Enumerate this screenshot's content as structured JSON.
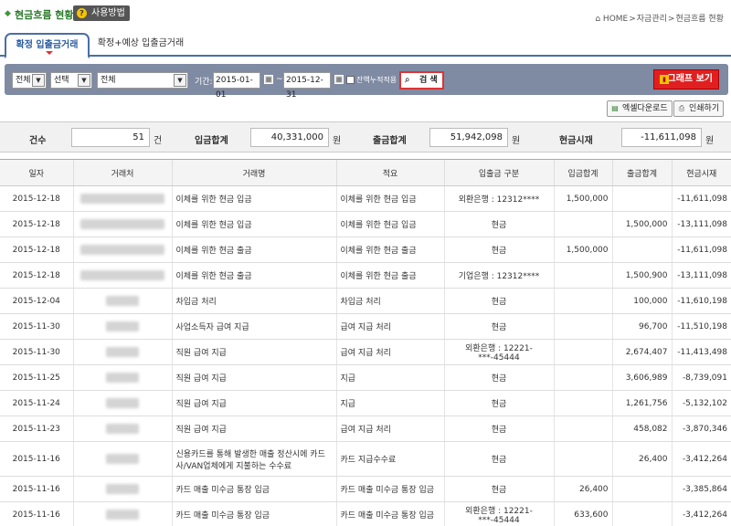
{
  "header": {
    "title": "현금흐름 현황",
    "help_label": "사용방법",
    "breadcrumb": [
      "HOME",
      "자금관리",
      "현금흐름 현황"
    ]
  },
  "tabs": [
    {
      "label": "확정 입출금거래",
      "active": true
    },
    {
      "label": "확정+예상 입출금거래",
      "active": false
    }
  ],
  "filters": {
    "select1": "전체",
    "select2": "선택",
    "select3": "전체",
    "period_label": "기간:",
    "date_from": "2015-01-01",
    "date_to": "2015-12-31",
    "period_sep": "~",
    "balance_checkbox_label": "잔액누적적용",
    "search_label": "검 색",
    "graph_label": "그래프 보기"
  },
  "toolbar": {
    "excel_label": "엑셀다운로드",
    "print_label": "인쇄하기"
  },
  "summary": {
    "count_label": "건수",
    "count_value": "51",
    "count_unit": "건",
    "in_label": "입금합계",
    "in_value": "40,331,000",
    "out_label": "출금합계",
    "out_value": "51,942,098",
    "balance_label": "현금시재",
    "balance_value": "-11,611,098",
    "won": "원"
  },
  "table": {
    "columns": [
      "일자",
      "거래처",
      "거래명",
      "적요",
      "입출금 구분",
      "입금합계",
      "출금합계",
      "현금시재"
    ],
    "rows": [
      {
        "date": "2015-12-18",
        "name": "이체를 위한 현금 입금",
        "memo": "이체를 위한 현금 입금",
        "type": "외환은행 : 12312****",
        "in": "1,500,000",
        "out": "",
        "balance": "-11,611,098"
      },
      {
        "date": "2015-12-18",
        "name": "이체를 위한 현금 입금",
        "memo": "이체를 위한 현금 입금",
        "type": "현금",
        "in": "",
        "out": "1,500,000",
        "balance": "-13,111,098"
      },
      {
        "date": "2015-12-18",
        "name": "이체를 위한 현금 출금",
        "memo": "이체를 위한 현금 출금",
        "type": "현금",
        "in": "1,500,000",
        "out": "",
        "balance": "-11,611,098"
      },
      {
        "date": "2015-12-18",
        "name": "이체를 위한 현금 출금",
        "memo": "이체를 위한 현금 출금",
        "type": "기업은행 : 12312****",
        "in": "",
        "out": "1,500,900",
        "balance": "-13,111,098"
      },
      {
        "date": "2015-12-04",
        "name": "차입금 처리",
        "memo": "차입금 처리",
        "type": "현금",
        "in": "",
        "out": "100,000",
        "balance": "-11,610,198"
      },
      {
        "date": "2015-11-30",
        "name": "사업소득자 급여 지급",
        "memo": "급여 지급 처리",
        "type": "현금",
        "in": "",
        "out": "96,700",
        "balance": "-11,510,198"
      },
      {
        "date": "2015-11-30",
        "name": "직원 급여 지급",
        "memo": "급여 지급 처리",
        "type": "외환은행 : 12221-***-45444",
        "in": "",
        "out": "2,674,407",
        "balance": "-11,413,498"
      },
      {
        "date": "2015-11-25",
        "name": "직원 급여 지급",
        "memo": "지급",
        "type": "현금",
        "in": "",
        "out": "3,606,989",
        "balance": "-8,739,091"
      },
      {
        "date": "2015-11-24",
        "name": "직원 급여 지급",
        "memo": "지급",
        "type": "현금",
        "in": "",
        "out": "1,261,756",
        "balance": "-5,132,102"
      },
      {
        "date": "2015-11-23",
        "name": "직원 급여 지급",
        "memo": "급여 지급 처리",
        "type": "현금",
        "in": "",
        "out": "458,082",
        "balance": "-3,870,346"
      },
      {
        "date": "2015-11-16",
        "name": "신용카드를 통해 발생한 매출 정산시에 카드사/VAN업체에게 지불하는 수수료",
        "memo": "카드 지급수수료",
        "type": "현금",
        "in": "",
        "out": "26,400",
        "balance": "-3,412,264"
      },
      {
        "date": "2015-11-16",
        "name": "카드 매출 미수금 통장 입금",
        "memo": "카드 매출 미수금 통장 입금",
        "type": "현금",
        "in": "26,400",
        "out": "",
        "balance": "-3,385,864"
      },
      {
        "date": "2015-11-16",
        "name": "카드 매출 미수금 통장 입금",
        "memo": "카드 매출 미수금 통장 입금",
        "type": "외환은행 : 12221-***-45444",
        "in": "633,600",
        "out": "",
        "balance": "-3,412,264"
      }
    ]
  },
  "colors": {
    "accent": "#4a6fa5",
    "search_bar": "#7f8aa3",
    "graph_button": "#e02020",
    "negative": "#e03030"
  }
}
